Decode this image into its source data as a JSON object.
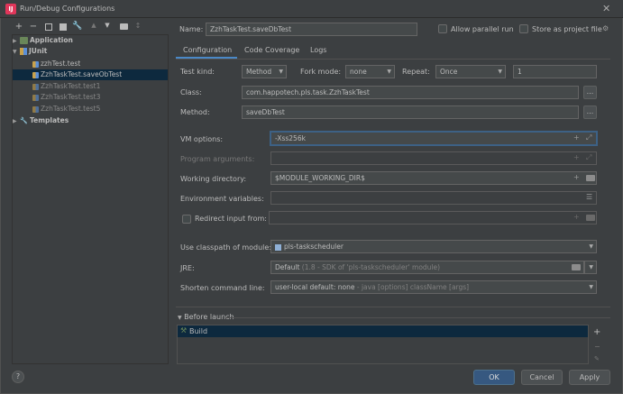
{
  "window": {
    "title": "Run/Debug Configurations"
  },
  "toolbar": {
    "add": "+",
    "remove": "−"
  },
  "tree": {
    "application": "Application",
    "junit": "JUnit",
    "items": [
      "zzhTest.test",
      "ZzhTaskTest.saveObTest",
      "ZzhTaskTest.test1",
      "ZzhTaskTest.test3",
      "ZzhTaskTest.test5"
    ],
    "templates": "Templates"
  },
  "header": {
    "name_label": "Name:",
    "name_value": "ZzhTaskTest.saveDbTest",
    "allow_parallel": "Allow parallel run",
    "store_project": "Store as project file"
  },
  "tabs": [
    "Configuration",
    "Code Coverage",
    "Logs"
  ],
  "config": {
    "test_kind_label": "Test kind:",
    "test_kind_value": "Method",
    "fork_mode_label": "Fork mode:",
    "fork_mode_value": "none",
    "repeat_label": "Repeat:",
    "repeat_value": "Once",
    "repeat_count": "1",
    "class_label": "Class:",
    "class_value": "com.happotech.pls.task.ZzhTaskTest",
    "method_label": "Method:",
    "method_value": "saveDbTest",
    "vm_label": "VM options:",
    "vm_value": "-Xss256k",
    "program_args_label": "Program arguments:",
    "working_dir_label": "Working directory:",
    "working_dir_value": "$MODULE_WORKING_DIR$",
    "env_label": "Environment variables:",
    "redirect_label": "Redirect input from:",
    "classpath_label": "Use classpath of module:",
    "classpath_value": "pls-taskscheduler",
    "jre_label": "JRE:",
    "jre_value_main": "Default",
    "jre_value_dim": "(1.8 - SDK of 'pls-taskscheduler' module)",
    "shorten_label": "Shorten command line:",
    "shorten_value_main": "user-local default: none",
    "shorten_value_dim": "- java [options] className [args]"
  },
  "before_launch": {
    "title": "Before launch",
    "item": "Build"
  },
  "buttons": {
    "ok": "OK",
    "cancel": "Cancel",
    "apply": "Apply",
    "help": "?"
  },
  "field_buttons": {
    "dots": "...",
    "plus": "+",
    "expand": "⤢"
  }
}
